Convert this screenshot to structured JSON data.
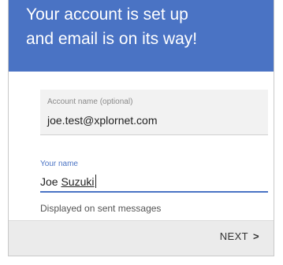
{
  "header": {
    "title_line1": "Your account is set up",
    "title_line2": "and email is on its way!"
  },
  "account_field": {
    "label": "Account name (optional)",
    "value": "joe.test@xplornet.com"
  },
  "name_field": {
    "label": "Your name",
    "value_first": "Joe ",
    "value_last": "Suzuki"
  },
  "helper_text": "Displayed on sent messages",
  "footer": {
    "next_label": "NEXT",
    "next_arrow": ">"
  },
  "colors": {
    "header_bg": "#4a73c4",
    "accent": "#4a73c4"
  },
  "icons": {
    "next": "chevron-right-icon"
  }
}
